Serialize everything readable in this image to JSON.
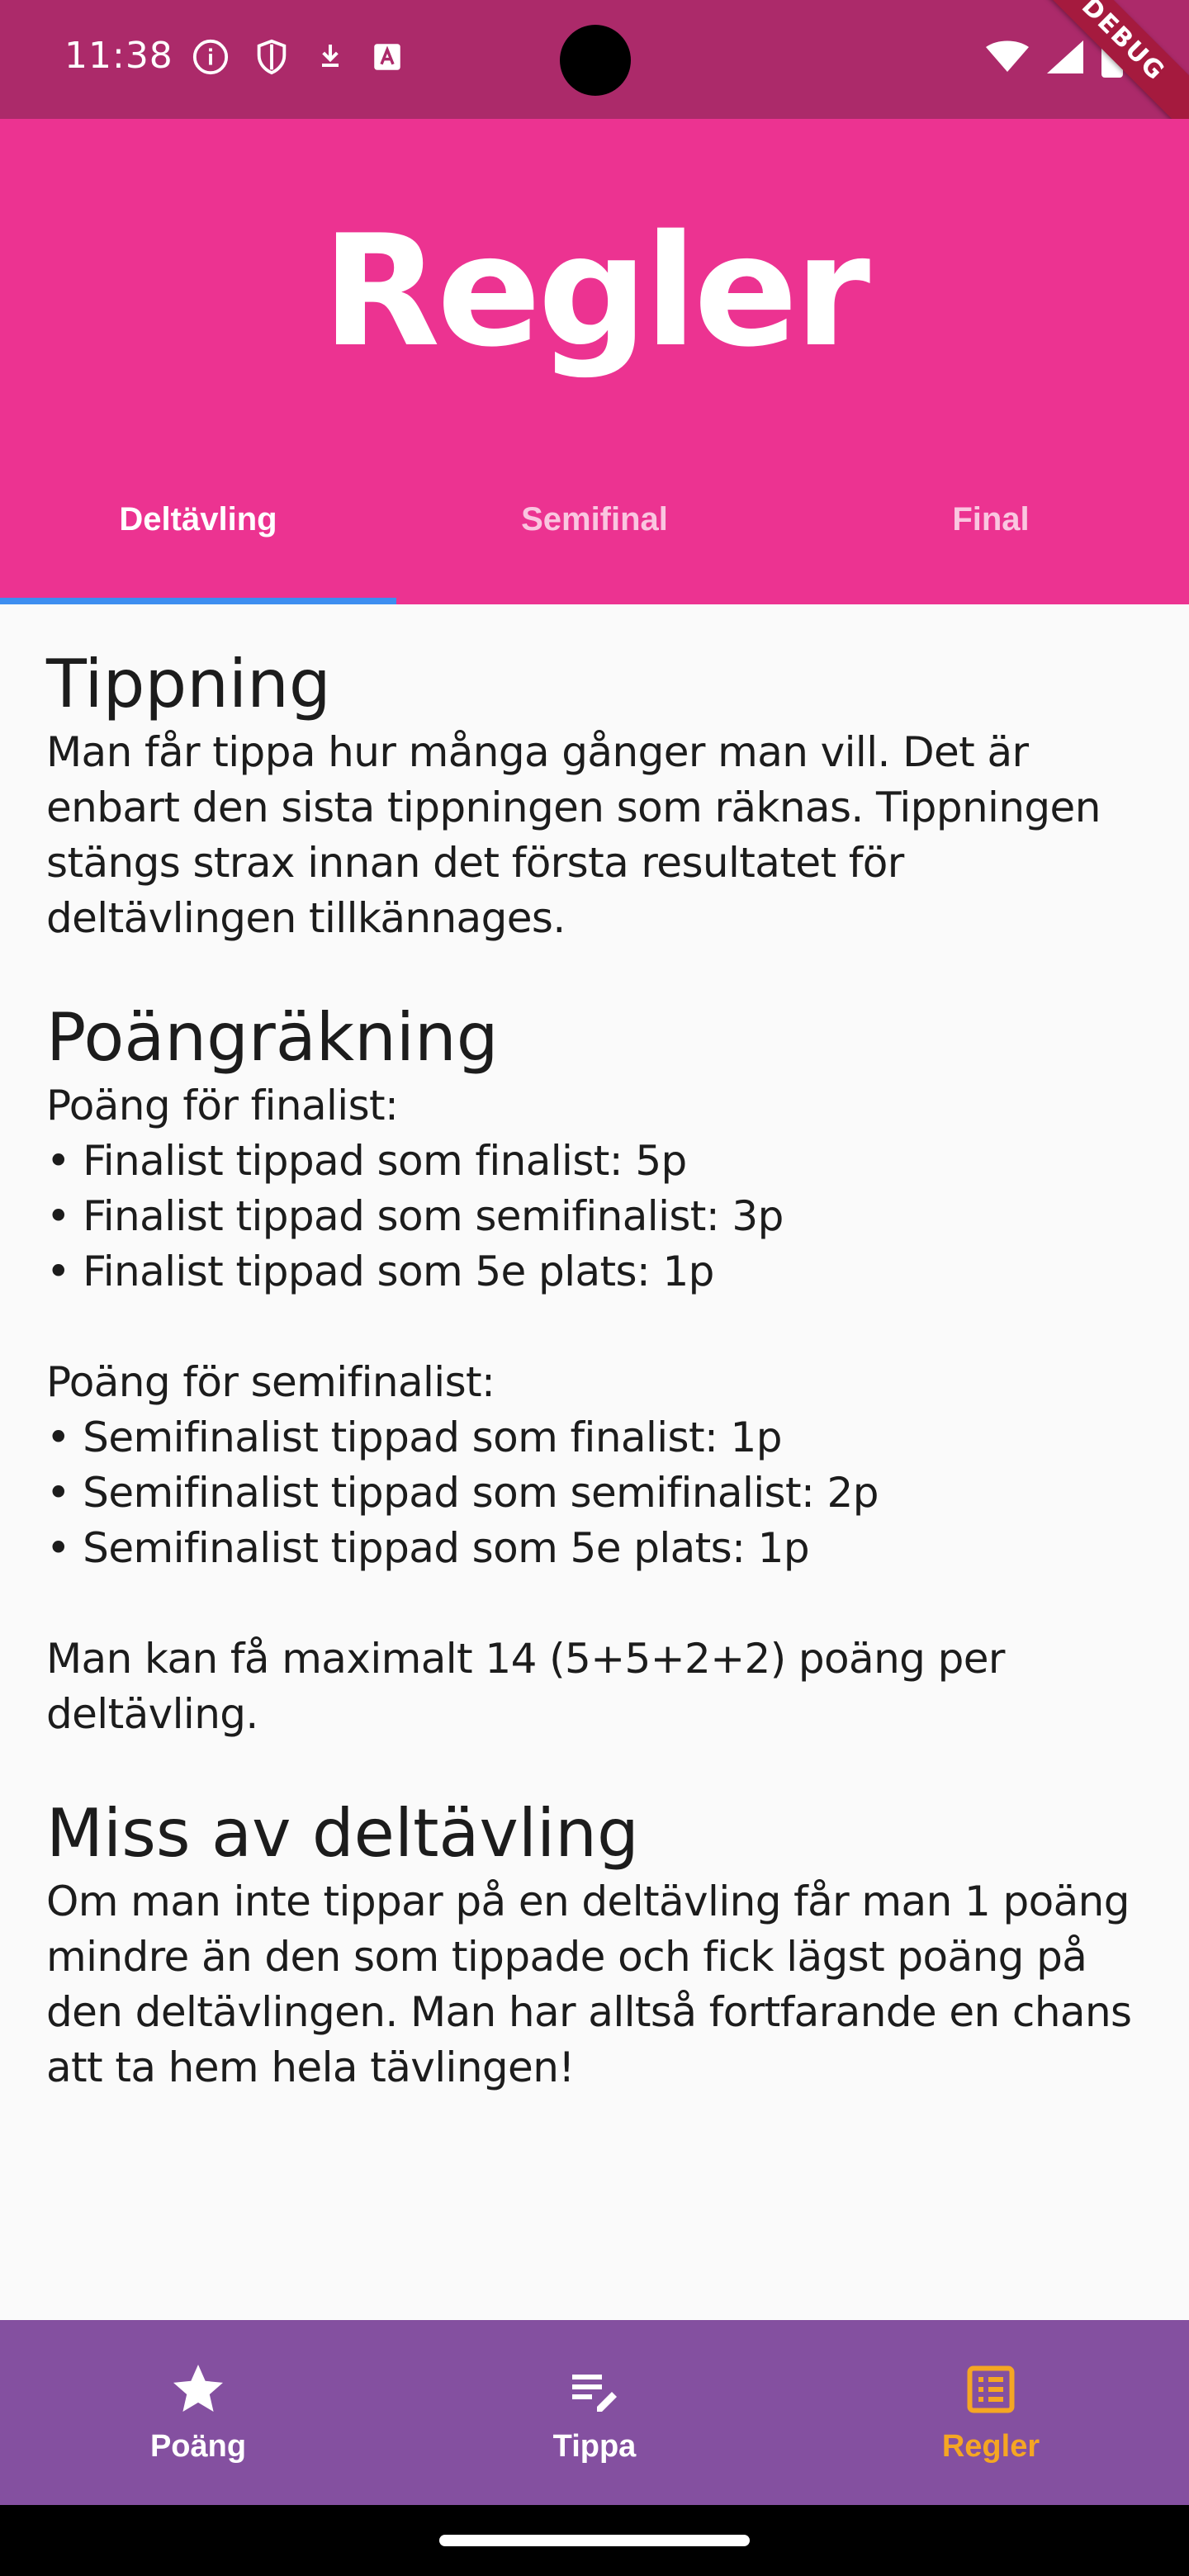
{
  "status_bar": {
    "time": "11:38",
    "debug_label": "DEBUG"
  },
  "header": {
    "title": "Regler"
  },
  "tabs": [
    {
      "label": "Deltävling",
      "active": true
    },
    {
      "label": "Semifinal",
      "active": false
    },
    {
      "label": "Final",
      "active": false
    }
  ],
  "sections": [
    {
      "title": "Tippning",
      "body": "Man får tippa hur många gånger man vill. Det är enbart den sista tippningen som räknas. Tippningen stängs strax innan det första resultatet för deltävlingen tillkännages."
    },
    {
      "title": "Poängräkning",
      "body": "Poäng för finalist:\n• Finalist tippad som finalist: 5p\n• Finalist tippad som semifinalist: 3p\n• Finalist tippad som 5e plats: 1p\n\nPoäng för semifinalist:\n• Semifinalist tippad som finalist: 1p\n• Semifinalist tippad som semifinalist: 2p\n• Semifinalist tippad som 5e plats: 1p\n\nMan kan få maximalt 14 (5+5+2+2) poäng per deltävling."
    },
    {
      "title": "Miss av deltävling",
      "body": "Om man inte tippar på en deltävling får man 1 poäng mindre än den som tippade och fick lägst poäng på den deltävlingen. Man har alltså fortfarande en chans att ta hem hela tävlingen!"
    }
  ],
  "bottom_nav": [
    {
      "label": "Poäng",
      "icon": "star-icon",
      "active": false
    },
    {
      "label": "Tippa",
      "icon": "edit-list-icon",
      "active": false
    },
    {
      "label": "Regler",
      "icon": "list-alt-icon",
      "active": true
    }
  ],
  "colors": {
    "status_bar": "#ac2a6a",
    "header": "#ec3391",
    "tab_indicator": "#3d8ef0",
    "bottom_nav": "#8450a0",
    "nav_active": "#f5a623"
  }
}
